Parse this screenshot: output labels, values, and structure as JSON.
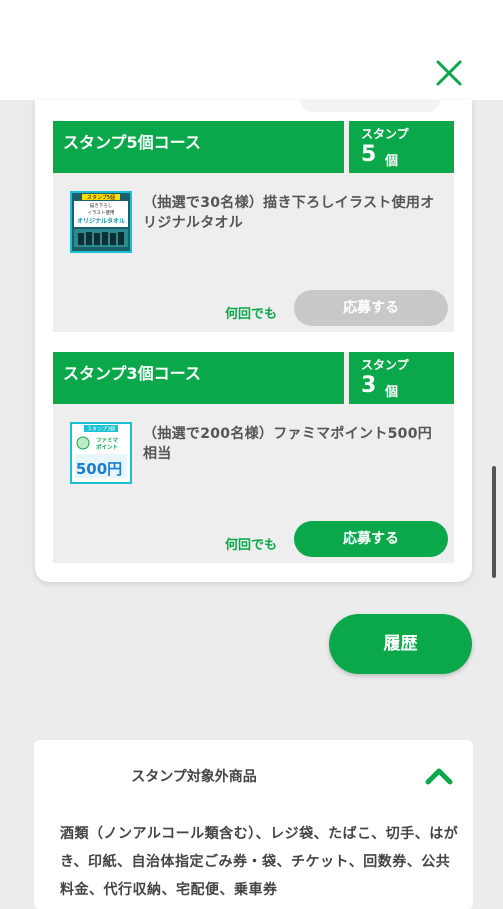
{
  "courses": [
    {
      "title": "スタンプ5個コース",
      "stamp_label": "スタンプ",
      "stamp_count": "5",
      "stamp_unit": "個",
      "prize": "（抽選で30名様）描き下ろしイラスト使用オリジナルタオル",
      "thumb": {
        "line1": "スタンプ5個",
        "line2": "描き下ろし",
        "line3": "イラスト使用",
        "line4": "オリジナルタオル"
      },
      "repeat_label": "何回でも",
      "apply_label": "応募する",
      "apply_enabled": false
    },
    {
      "title": "スタンプ3個コース",
      "stamp_label": "スタンプ",
      "stamp_count": "3",
      "stamp_unit": "個",
      "prize": "（抽選で200名様）ファミマポイント500円相当",
      "thumb": {
        "line1": "スタンプ3個",
        "line2": "ファミマ",
        "line3": "ポイント",
        "line4": "500円"
      },
      "repeat_label": "何回でも",
      "apply_label": "応募する",
      "apply_enabled": true
    }
  ],
  "history_label": "履歴",
  "excluded": {
    "title": "スタンプ対象外商品",
    "body": "酒類（ノンアルコール類含む）、レジ袋、たばこ、切手、はがき、印紙、自治体指定ごみ券・袋、チケット、回数券、公共料金、代行収納、宅配便、乗車券"
  },
  "colors": {
    "accent": "#0aa84b",
    "disabled": "#c8c8c8",
    "background": "#ececec"
  },
  "icons": {
    "close": "close-icon",
    "collapse": "chevron-up-icon"
  }
}
